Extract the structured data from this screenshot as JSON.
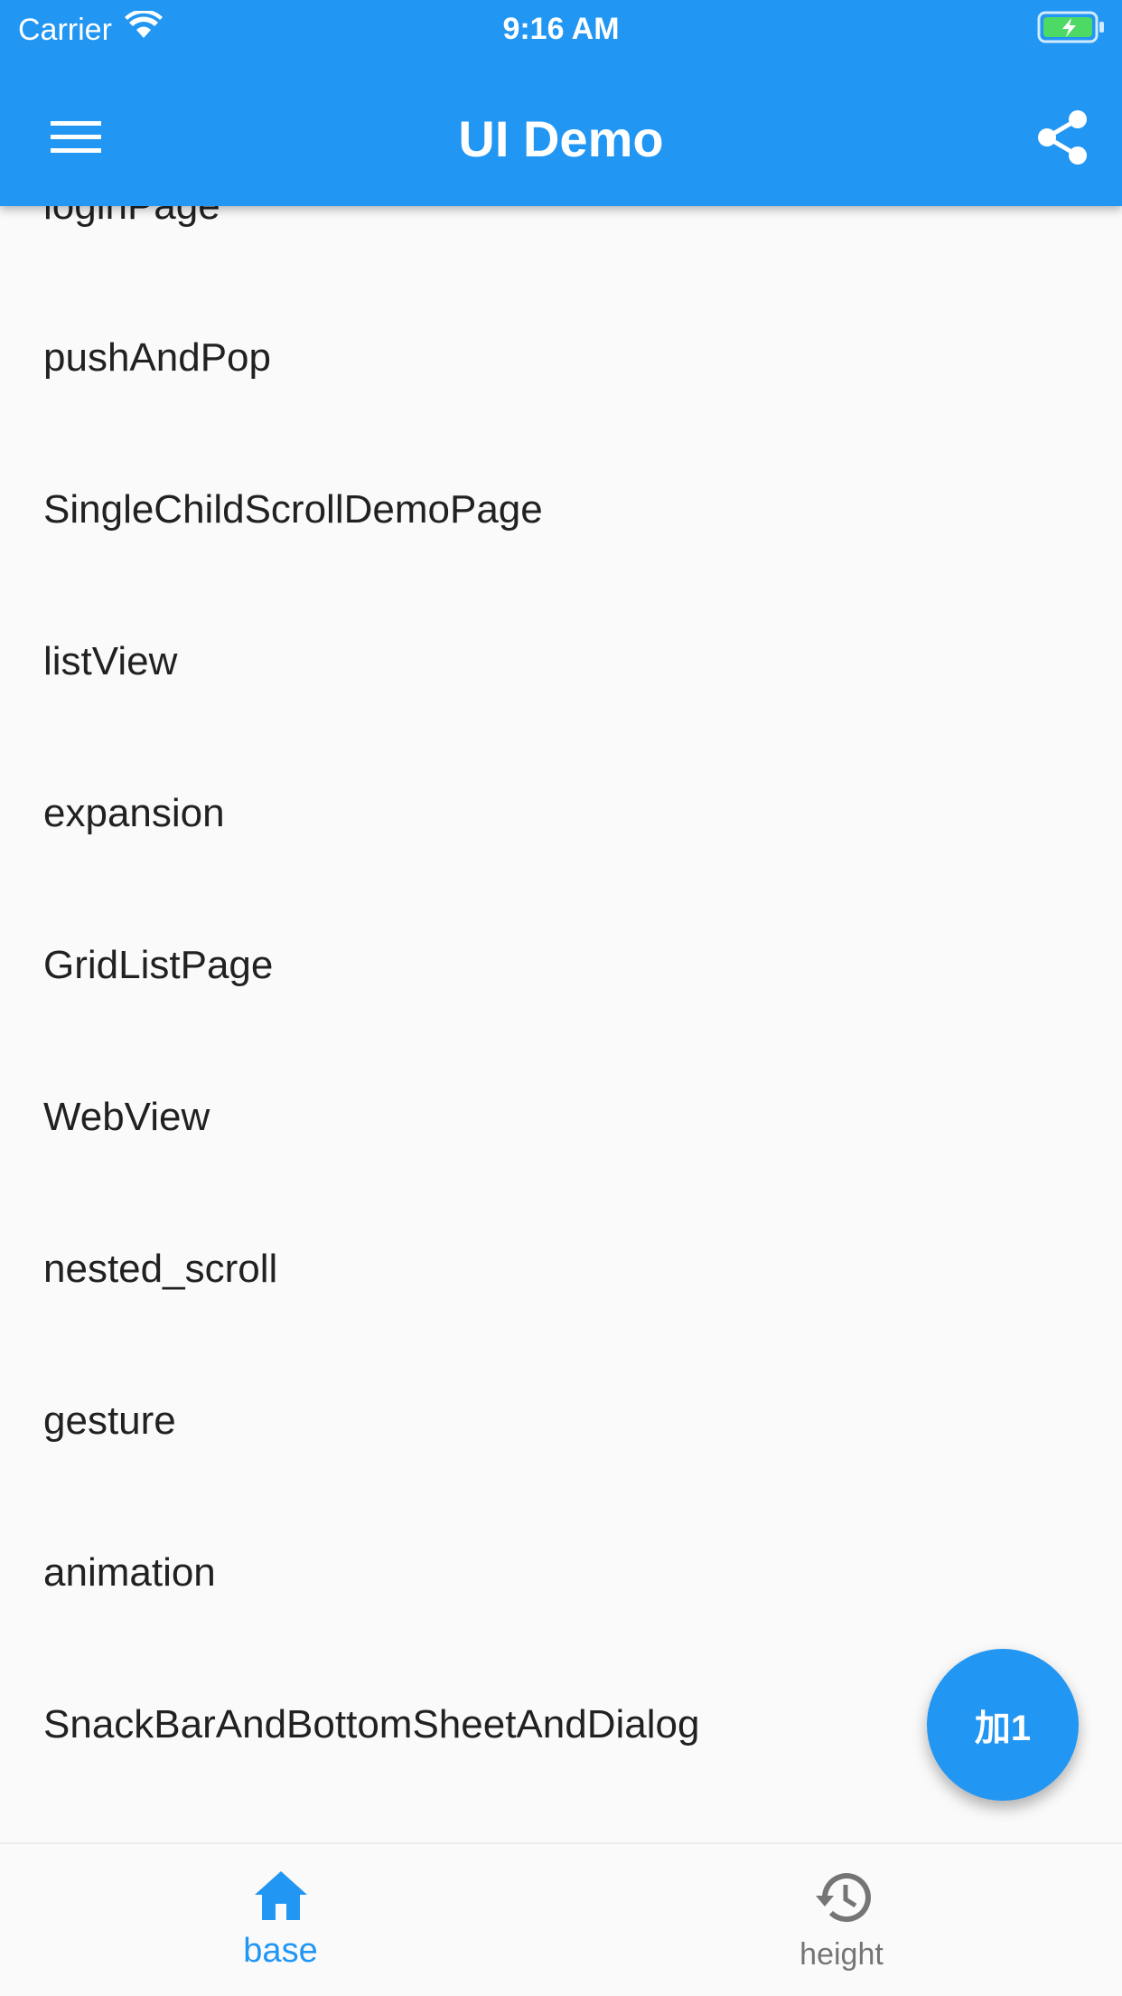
{
  "status_bar": {
    "carrier": "Carrier",
    "time": "9:16 AM"
  },
  "app_bar": {
    "title": "UI Demo",
    "menu_icon": "menu-icon",
    "share_icon": "share-icon"
  },
  "list": {
    "items": [
      {
        "label": "loginPage"
      },
      {
        "label": "pushAndPop"
      },
      {
        "label": "SingleChildScrollDemoPage"
      },
      {
        "label": "listView"
      },
      {
        "label": "expansion"
      },
      {
        "label": "GridListPage"
      },
      {
        "label": "WebView"
      },
      {
        "label": "nested_scroll"
      },
      {
        "label": "gesture"
      },
      {
        "label": "animation"
      },
      {
        "label": "SnackBarAndBottomSheetAndDialog"
      }
    ]
  },
  "fab": {
    "label": "加1"
  },
  "bottom_nav": {
    "items": [
      {
        "label": "base",
        "icon": "home-icon",
        "selected": true
      },
      {
        "label": "height",
        "icon": "history-icon",
        "selected": false
      }
    ]
  },
  "colors": {
    "primary": "#2196f3",
    "background": "#fafafa",
    "text": "#212121",
    "inactive": "#757575"
  }
}
